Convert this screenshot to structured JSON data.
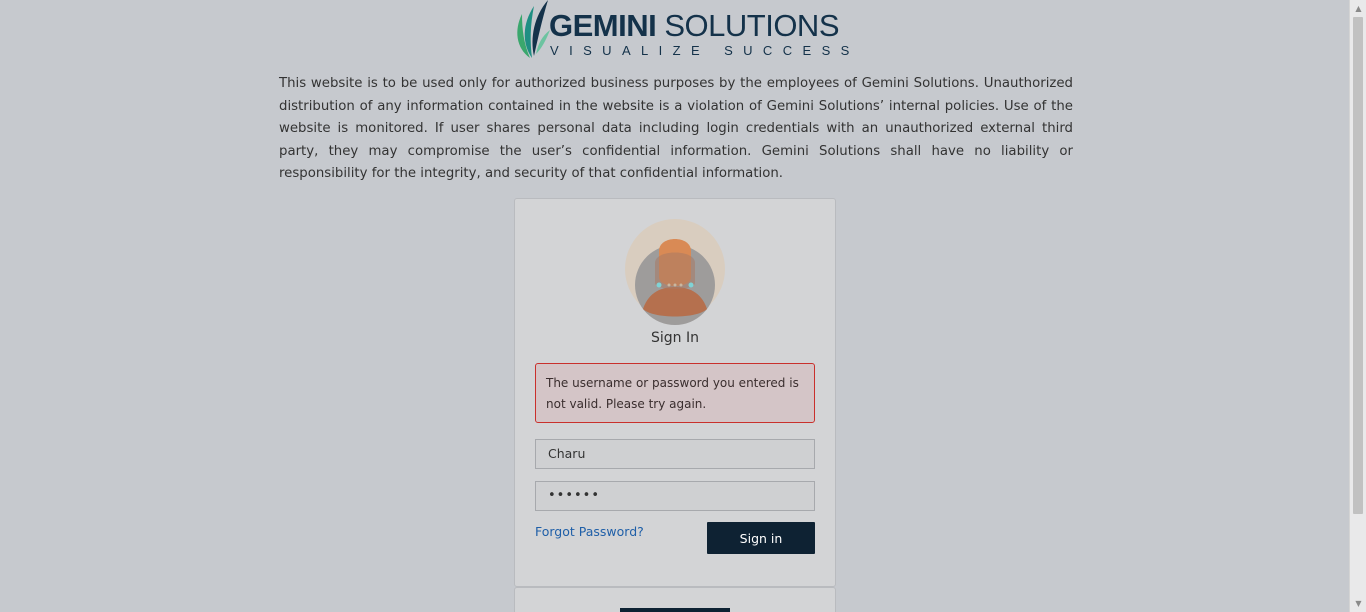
{
  "logo": {
    "brand_bold": "GEMINI",
    "brand_regular": " SOLUTIONS",
    "tagline": "VISUALIZE SUCCESS"
  },
  "disclaimer": "This website is to be used only for authorized business purposes by the employees of Gemini Solutions. Unauthorized distribution of any information contained in the website is a violation of Gemini Solutions’ internal policies. Use of the website is monitored. If user shares personal data including login credentials with an unauthorized external third party, they may compromise the user’s confidential information. Gemini Solutions shall have no liability or responsibility for the integrity, and security of that confidential information.",
  "signin": {
    "title": "Sign In",
    "error": "The username or password you entered is not valid. Please try again.",
    "username_value": "Charu",
    "password_masked": "••••••",
    "forgot_label": "Forgot Password?",
    "button_label": "Sign in"
  },
  "icons": {
    "avatar": "user-avatar-icon",
    "scroll_up": "arrow-up-icon",
    "scroll_down": "arrow-down-icon"
  },
  "colors": {
    "background": "#c6c9ce",
    "brand_navy": "#14324a",
    "button": "#0e2233",
    "error_border": "#c9302c",
    "link": "#1f5fa8"
  }
}
